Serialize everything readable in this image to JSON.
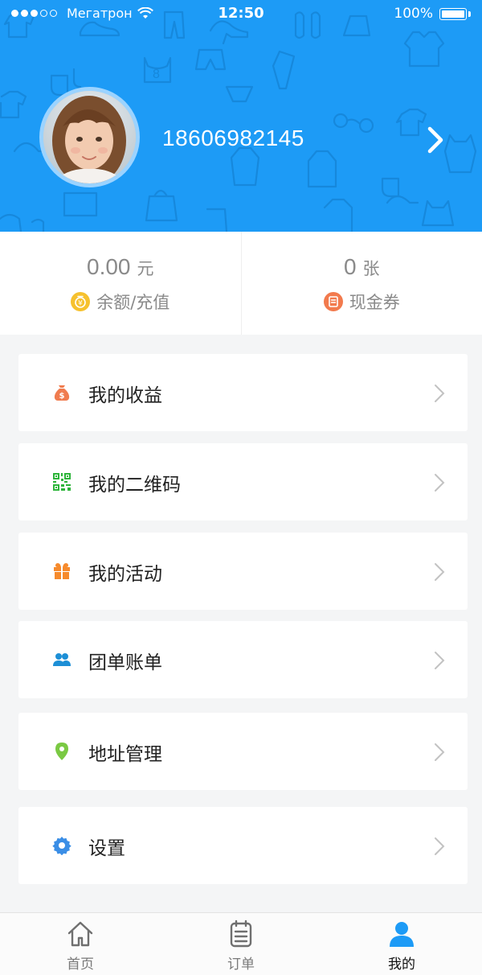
{
  "status_bar": {
    "carrier": "Мегатрон",
    "time": "12:50",
    "battery": "100%"
  },
  "profile": {
    "phone": "18606982145"
  },
  "stats": [
    {
      "value": "0.00",
      "unit": "元",
      "label": "余额/充值",
      "icon": "coin-icon",
      "color": "#f6c12e"
    },
    {
      "value": "0",
      "unit": "张",
      "label": "现金券",
      "icon": "coupon-icon",
      "color": "#f27a4d"
    }
  ],
  "menu": [
    {
      "label": "我的收益",
      "icon": "money-bag-icon",
      "color": "#f07c4f"
    },
    {
      "label": "我的二维码",
      "icon": "qr-code-icon",
      "color": "#2db43a"
    },
    {
      "label": "我的活动",
      "icon": "gift-icon",
      "color": "#f68a2c"
    },
    {
      "label": "团单账单",
      "icon": "group-icon",
      "color": "#1d8fd6"
    },
    {
      "label": "地址管理",
      "icon": "location-pin-icon",
      "color": "#7ac943"
    },
    {
      "label": "设置",
      "icon": "gear-icon",
      "color": "#3a8ee6"
    }
  ],
  "tabs": [
    {
      "label": "首页",
      "icon": "home-icon",
      "active": false
    },
    {
      "label": "订单",
      "icon": "clipboard-icon",
      "active": false
    },
    {
      "label": "我的",
      "icon": "user-icon",
      "active": true
    }
  ],
  "colors": {
    "header_bg": "#1d9bf6",
    "active_tab": "#1d9bf6"
  }
}
